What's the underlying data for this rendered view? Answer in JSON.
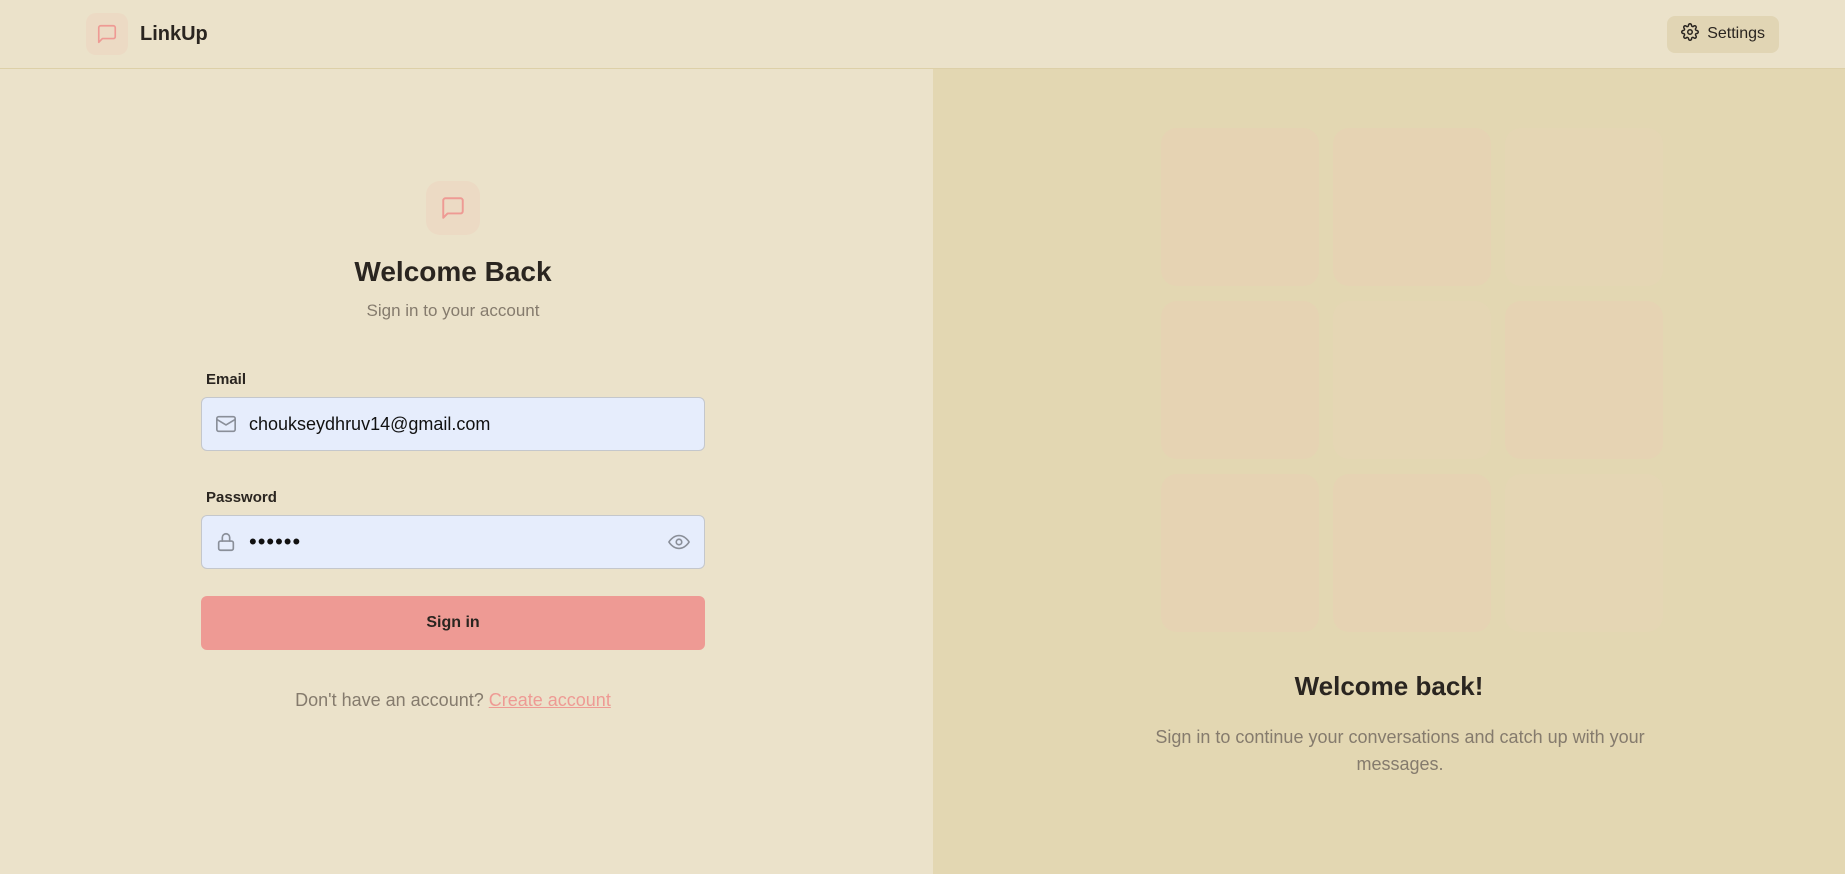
{
  "app": {
    "name": "LinkUp"
  },
  "header": {
    "settings_label": "Settings"
  },
  "login": {
    "title": "Welcome Back",
    "subtitle": "Sign in to your account",
    "email_label": "Email",
    "email_value": "choukseydhruv14@gmail.com",
    "password_label": "Password",
    "password_value": "••••••",
    "signin_label": "Sign in",
    "signup_prompt": "Don't have an account?",
    "signup_link": "Create account"
  },
  "promo": {
    "title": "Welcome back!",
    "text": "Sign in to continue your conversations and catch up with your messages."
  },
  "icons": {
    "brand": "message-square-icon",
    "settings": "gear-icon",
    "email": "mail-icon",
    "password": "lock-icon",
    "toggle": "eye-icon"
  },
  "colors": {
    "background": "#ebe2ca",
    "panel": "#e3d7b2",
    "accent": "#ee9a94",
    "input_bg": "#e6edfc"
  }
}
